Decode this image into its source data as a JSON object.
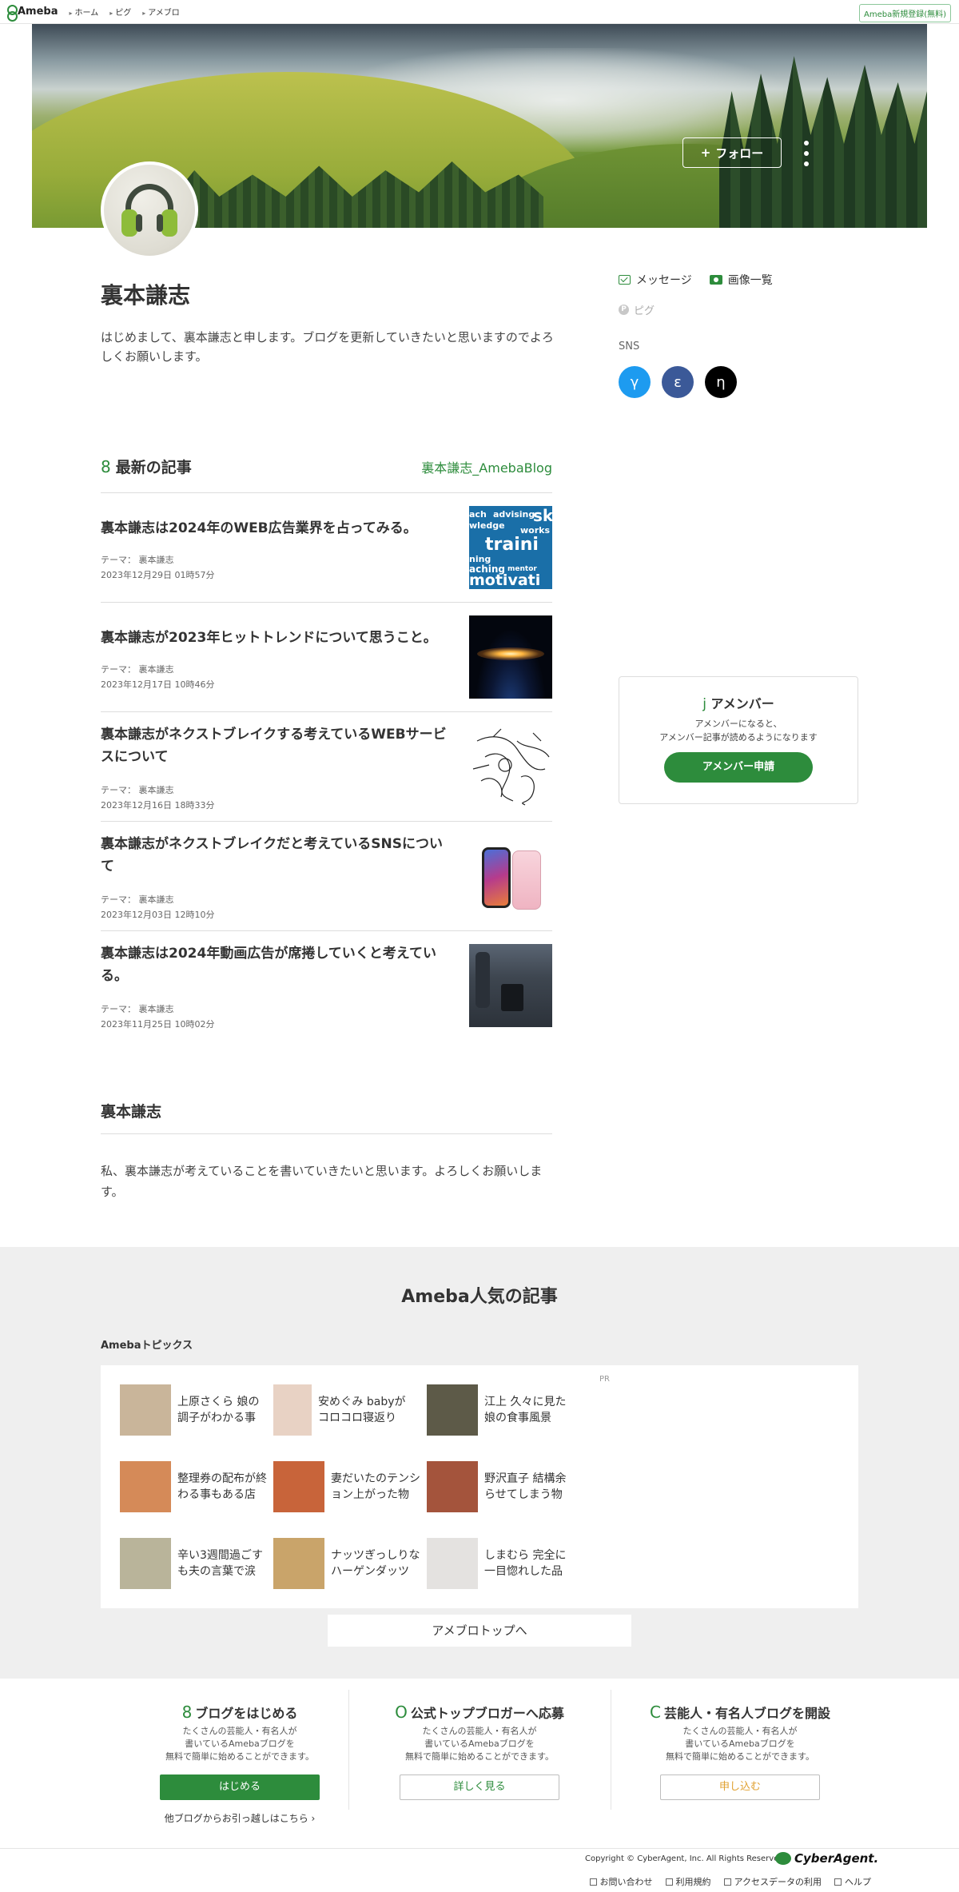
{
  "topbar": {
    "logo": "Ameba",
    "crumbs": [
      "ホーム",
      "ピグ",
      "アメブロ"
    ],
    "signup": "Ameba新規登録(無料)"
  },
  "hero": {
    "follow_label": "フォロー",
    "follow_plus": "+"
  },
  "profile": {
    "name": "裏本謙志",
    "bio": "はじめまして、裏本謙志と申します。ブログを更新していきたいと思いますのでよろしくお願いします。",
    "message_label": "メッセージ",
    "images_label": "画像一覧",
    "pigg_label": "ピグ",
    "sns_label": "SNS",
    "sns": [
      {
        "glyph": "γ",
        "color": "#1d9bf0"
      },
      {
        "glyph": "ε",
        "color": "#3b5998"
      },
      {
        "glyph": "η",
        "color": "#000000"
      }
    ]
  },
  "latest": {
    "glyph": "8",
    "title": "最新の記事",
    "blog_link": "裏本謙志_AmebaBlog",
    "articles": [
      {
        "title": "裏本謙志は2024年のWEB広告業界を占ってみる。",
        "theme": "テーマ： 裏本謙志",
        "date": "2023年12月29日 01時57分"
      },
      {
        "title": "裏本謙志が2023年ヒットトレンドについて思うこと。",
        "theme": "テーマ： 裏本謙志",
        "date": "2023年12月17日 10時46分"
      },
      {
        "title": "裏本謙志がネクストブレイクする考えているWEBサービスについて",
        "theme": "テーマ： 裏本謙志",
        "date": "2023年12月16日 18時33分"
      },
      {
        "title": "裏本謙志がネクストブレイクだと考えているSNSについて",
        "theme": "テーマ： 裏本謙志",
        "date": "2023年12月03日 12時10分"
      },
      {
        "title": "裏本謙志は2024年動画広告が席捲していくと考えている。",
        "theme": "テーマ： 裏本謙志",
        "date": "2023年11月25日 10時02分"
      }
    ]
  },
  "thumb1_words": [
    "ach",
    "advising",
    "sk",
    "wledge",
    "works",
    "traini",
    "ning",
    "aching",
    "mentor",
    "motivati"
  ],
  "about": {
    "title": "裏本謙志",
    "text": "私、裏本謙志が考えていることを書いていきたいと思います。よろしくお願いします。"
  },
  "amember": {
    "glyph": "j",
    "title": "アメンバー",
    "desc1": "アメンバーになると、",
    "desc2": "アメンバー記事が読めるようになります",
    "button": "アメンバー申請"
  },
  "popular": {
    "title": "Ameba人気の記事",
    "topics_label": "Amebaトピックス",
    "pr": "PR",
    "topics": [
      {
        "line1": "上原さくら 娘の",
        "line2": "調子がわかる事",
        "color": "#c9b59a"
      },
      {
        "line1": "安めぐみ babyが",
        "line2": "コロコロ寝返り",
        "color": "#e8d2c4"
      },
      {
        "line1": "江上 久々に見た",
        "line2": "娘の食事風景",
        "color": "#5d5a48"
      },
      {
        "line1": "整理券の配布が終",
        "line2": "わる事もある店",
        "color": "#d58a58"
      },
      {
        "line1": "妻だいたのテンシ",
        "line2": "ョン上がった物",
        "color": "#c8643a"
      },
      {
        "line1": "野沢直子 結構余",
        "line2": "らせてしまう物",
        "color": "#a4543c"
      },
      {
        "line1": "辛い3週間過ごす",
        "line2": "も夫の言葉で涙",
        "color": "#b9b49a"
      },
      {
        "line1": "ナッツぎっしりな",
        "line2": "ハーゲンダッツ",
        "color": "#c9a46a"
      },
      {
        "line1": "しまむら 完全に",
        "line2": "一目惚れした品",
        "color": "#e4e2e0"
      }
    ],
    "to_top": "アメブロトップへ"
  },
  "cta": [
    {
      "glyph": "8",
      "title": "ブログをはじめる",
      "desc1": "たくさんの芸能人・有名人が",
      "desc2": "書いているAmebaブログを",
      "desc3": "無料で簡単に始めることができます。",
      "button": "はじめる",
      "sub": "他ブログからお引っ越しはこちら ›"
    },
    {
      "glyph": "O",
      "title": "公式トップブロガーへ応募",
      "desc1": "たくさんの芸能人・有名人が",
      "desc2": "書いているAmebaブログを",
      "desc3": "無料で簡単に始めることができます。",
      "button": "詳しく見る"
    },
    {
      "glyph": "C",
      "title": "芸能人・有名人ブログを開設",
      "desc1": "たくさんの芸能人・有名人が",
      "desc2": "書いているAmebaブログを",
      "desc3": "無料で簡単に始めることができます。",
      "button": "申し込む"
    }
  ],
  "footer": {
    "copyright": "Copyright © CyberAgent, Inc. All Rights Reserved.",
    "brand": "CyberAgent.",
    "links": [
      "お問い合わせ",
      "利用規約",
      "アクセスデータの利用",
      "ヘルプ"
    ]
  },
  "colors": {
    "accent": "#2d8c3c",
    "cta_orange": "#e0a030"
  }
}
